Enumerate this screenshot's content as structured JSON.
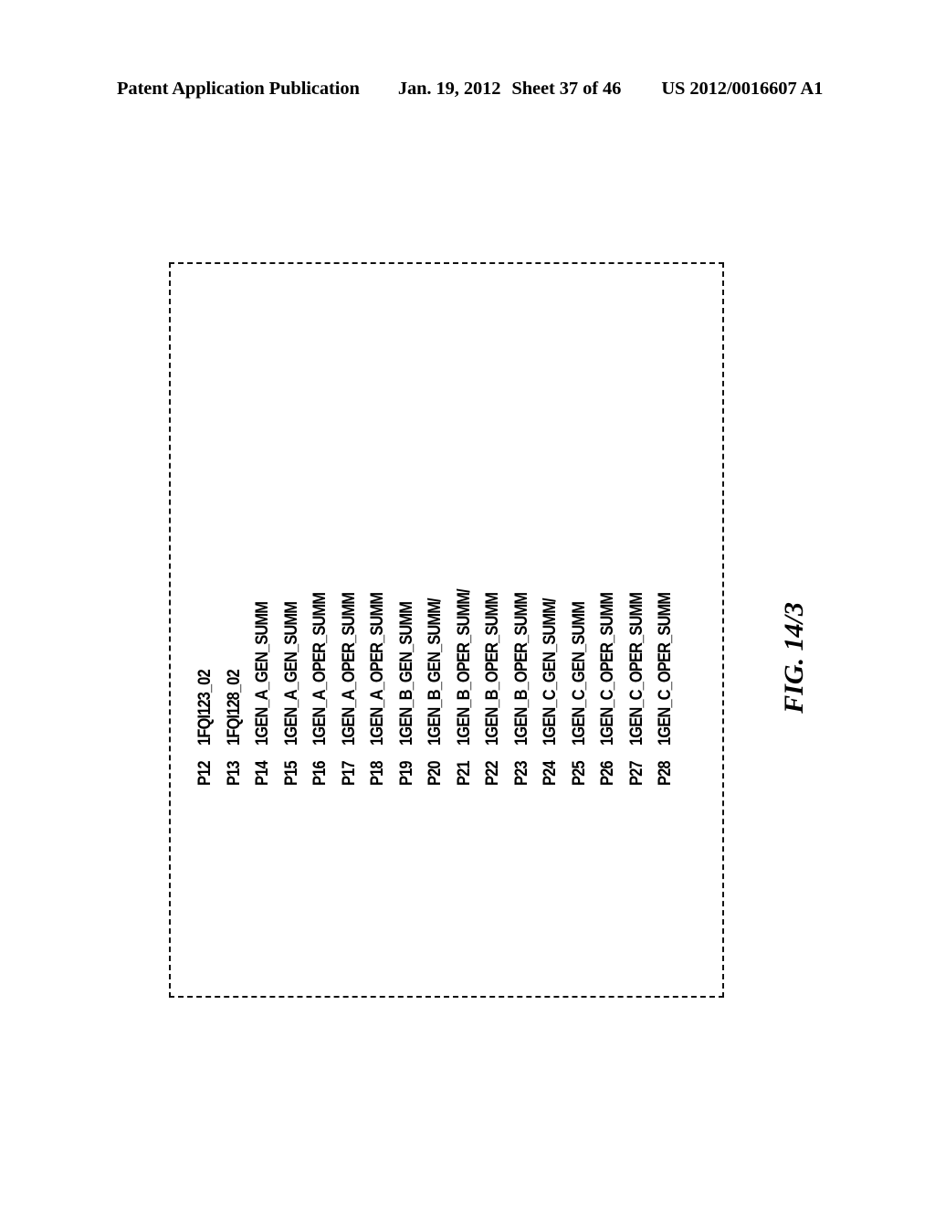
{
  "header": {
    "publication": "Patent Application Publication",
    "date": "Jan. 19, 2012",
    "sheet": "Sheet 37 of 46",
    "publication_number": "US 2012/0016607 A1"
  },
  "figure": {
    "caption": "FIG. 14/3",
    "border_style": "dashed",
    "border_color": "#111111",
    "rows": [
      {
        "id": "P12",
        "name": "1FQI123_02"
      },
      {
        "id": "P13",
        "name": "1FQI128_02"
      },
      {
        "id": "P14",
        "name": "1GEN_A_GEN_SUMM"
      },
      {
        "id": "P15",
        "name": "1GEN_A_GEN_SUMM"
      },
      {
        "id": "P16",
        "name": "1GEN_A_OPER_SUMM"
      },
      {
        "id": "P17",
        "name": "1GEN_A_OPER_SUMM"
      },
      {
        "id": "P18",
        "name": "1GEN_A_OPER_SUMM"
      },
      {
        "id": "P19",
        "name": "1GEN_B_GEN_SUMM"
      },
      {
        "id": "P20",
        "name": "1GEN_B_GEN_SUMM/"
      },
      {
        "id": "P21",
        "name": "1GEN_B_OPER_SUMM/"
      },
      {
        "id": "P22",
        "name": "1GEN_B_OPER_SUMM"
      },
      {
        "id": "P23",
        "name": "1GEN_B_OPER_SUMM"
      },
      {
        "id": "P24",
        "name": "1GEN_C_GEN_SUMM/"
      },
      {
        "id": "P25",
        "name": "1GEN_C_GEN_SUMM"
      },
      {
        "id": "P26",
        "name": "1GEN_C_OPER_SUMM"
      },
      {
        "id": "P27",
        "name": "1GEN_C_OPER_SUMM"
      },
      {
        "id": "P28",
        "name": "1GEN_C_OPER_SUMM"
      }
    ]
  }
}
